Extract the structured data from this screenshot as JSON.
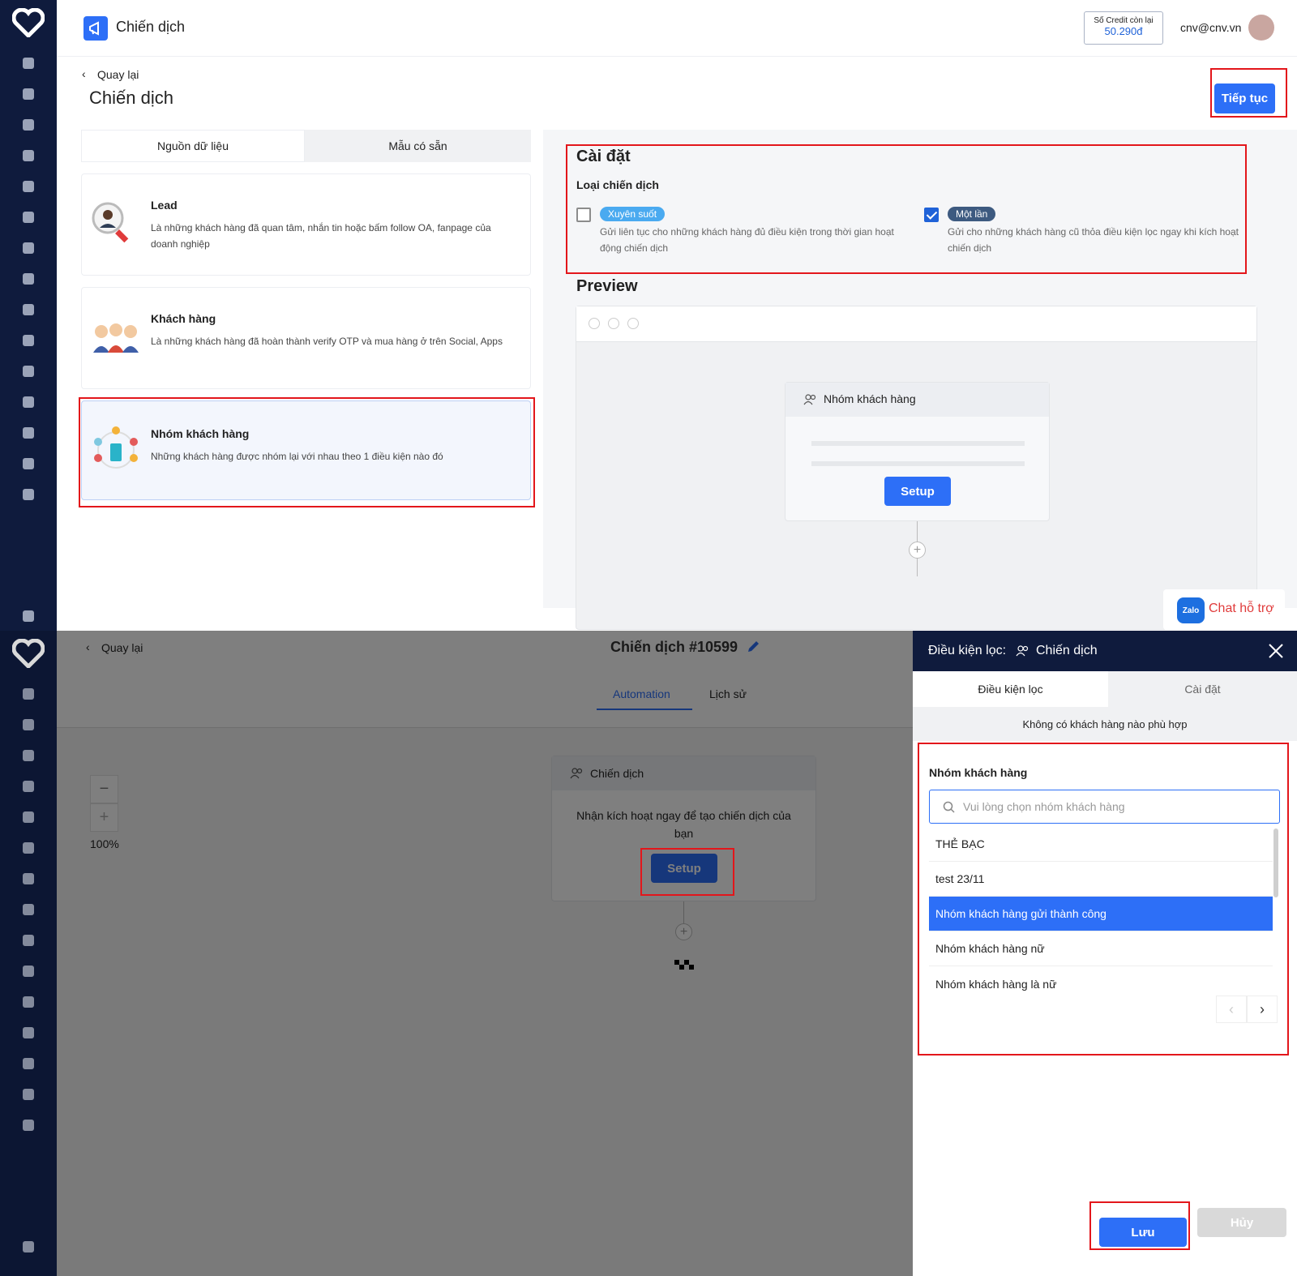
{
  "top": {
    "header": {
      "title": "Chiến dịch",
      "credit_label": "Số Credit còn lại",
      "credit_value": "50.290đ",
      "user_email": "cnv@cnv.vn"
    },
    "back_label": "Quay lại",
    "page_title": "Chiến dịch",
    "continue_button": "Tiếp tục",
    "tabs": [
      "Nguồn dữ liệu",
      "Mẫu có sẵn"
    ],
    "sources": [
      {
        "title": "Lead",
        "desc": "Là những khách hàng đã quan tâm, nhắn tin hoặc bấm follow OA, fanpage của doanh nghiệp"
      },
      {
        "title": "Khách hàng",
        "desc": "Là những khách hàng đã hoàn thành verify OTP và mua hàng ở trên Social, Apps"
      },
      {
        "title": "Nhóm khách hàng",
        "desc": "Những khách hàng được nhóm lại với nhau theo 1 điều kiện nào đó"
      }
    ],
    "settings": {
      "title": "Cài đặt",
      "type_label": "Loại chiến dịch",
      "option1_tag": "Xuyên suốt",
      "option1_desc": "Gửi liên tục cho những khách hàng đủ điều kiện trong thời gian hoạt động chiến dịch",
      "option1_checked": false,
      "option2_tag": "Một lần",
      "option2_desc": "Gửi cho những khách hàng cũ thỏa điều kiện lọc ngay khi kích hoạt chiến dịch",
      "option2_checked": true
    },
    "preview": {
      "title": "Preview",
      "node_title": "Nhóm khách hàng",
      "setup_button": "Setup"
    },
    "chat": {
      "zalo": "Zalo",
      "label": "Chat hỗ trợ"
    }
  },
  "bottom": {
    "back_label": "Quay lại",
    "campaign_title": "Chiến dịch #10599",
    "tabs": [
      "Automation",
      "Lịch sử"
    ],
    "zoom": "100%",
    "zoom_minus": "−",
    "zoom_plus": "+",
    "node_title": "Chiến dịch",
    "node_desc": "Nhận kích hoạt ngay để tạo chiến dịch của bạn",
    "setup_button": "Setup",
    "drawer": {
      "title": "Điều kiện lọc:",
      "title_suffix": "Chiến dịch",
      "tabs": [
        "Điều kiện lọc",
        "Cài đặt"
      ],
      "no_match": "Không có khách hàng nào phù hợp",
      "group_label": "Nhóm khách hàng",
      "search_placeholder": "Vui lòng chọn nhóm khách hàng",
      "options": [
        "THẺ BẠC",
        "test 23/11",
        "Nhóm khách hàng gửi thành công",
        "Nhóm khách hàng nữ",
        "Nhóm khách hàng là nữ"
      ],
      "selected_index": 2,
      "save_button": "Lưu",
      "cancel_button": "Hủy"
    }
  }
}
